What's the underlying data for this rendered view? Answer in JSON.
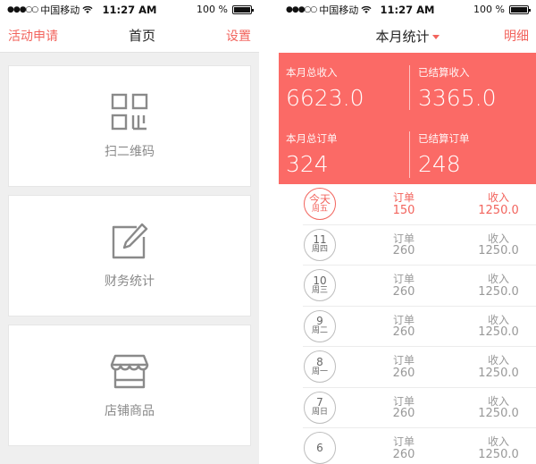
{
  "status_bar": {
    "carrier": "中国移动",
    "time": "11:27 AM",
    "battery": "100 %"
  },
  "screen1": {
    "nav": {
      "left": "活动申请",
      "title": "首页",
      "right": "设置"
    },
    "tiles": [
      {
        "label": "扫二维码",
        "icon": "qr-code-icon"
      },
      {
        "label": "财务统计",
        "icon": "edit-pen-icon"
      },
      {
        "label": "店铺商品",
        "icon": "store-awning-icon"
      }
    ]
  },
  "screen2": {
    "nav": {
      "title": "本月统计",
      "right": "明细"
    },
    "summary": [
      {
        "label": "本月总收入",
        "value": "6623.0"
      },
      {
        "label": "已结算收入",
        "value": "3365.0"
      },
      {
        "label": "本月总订单",
        "value": "324"
      },
      {
        "label": "已结算订单",
        "value": "248"
      }
    ],
    "rows": [
      {
        "day": "今天",
        "weekday": "周五",
        "order_label": "订单",
        "orders": "150",
        "income_label": "收入",
        "income": "1250.0",
        "today": true
      },
      {
        "day": "11",
        "weekday": "周四",
        "order_label": "订单",
        "orders": "260",
        "income_label": "收入",
        "income": "1250.0",
        "today": false
      },
      {
        "day": "10",
        "weekday": "周三",
        "order_label": "订单",
        "orders": "260",
        "income_label": "收入",
        "income": "1250.0",
        "today": false
      },
      {
        "day": "9",
        "weekday": "周二",
        "order_label": "订单",
        "orders": "260",
        "income_label": "收入",
        "income": "1250.0",
        "today": false
      },
      {
        "day": "8",
        "weekday": "周一",
        "order_label": "订单",
        "orders": "260",
        "income_label": "收入",
        "income": "1250.0",
        "today": false
      },
      {
        "day": "7",
        "weekday": "周日",
        "order_label": "订单",
        "orders": "260",
        "income_label": "收入",
        "income": "1250.0",
        "today": false
      },
      {
        "day": "6",
        "weekday": "",
        "order_label": "订单",
        "orders": "260",
        "income_label": "收入",
        "income": "1250.0",
        "today": false
      }
    ]
  },
  "colors": {
    "accent": "#f2645d",
    "summary_bg": "#fb6a66",
    "muted": "#999999"
  }
}
